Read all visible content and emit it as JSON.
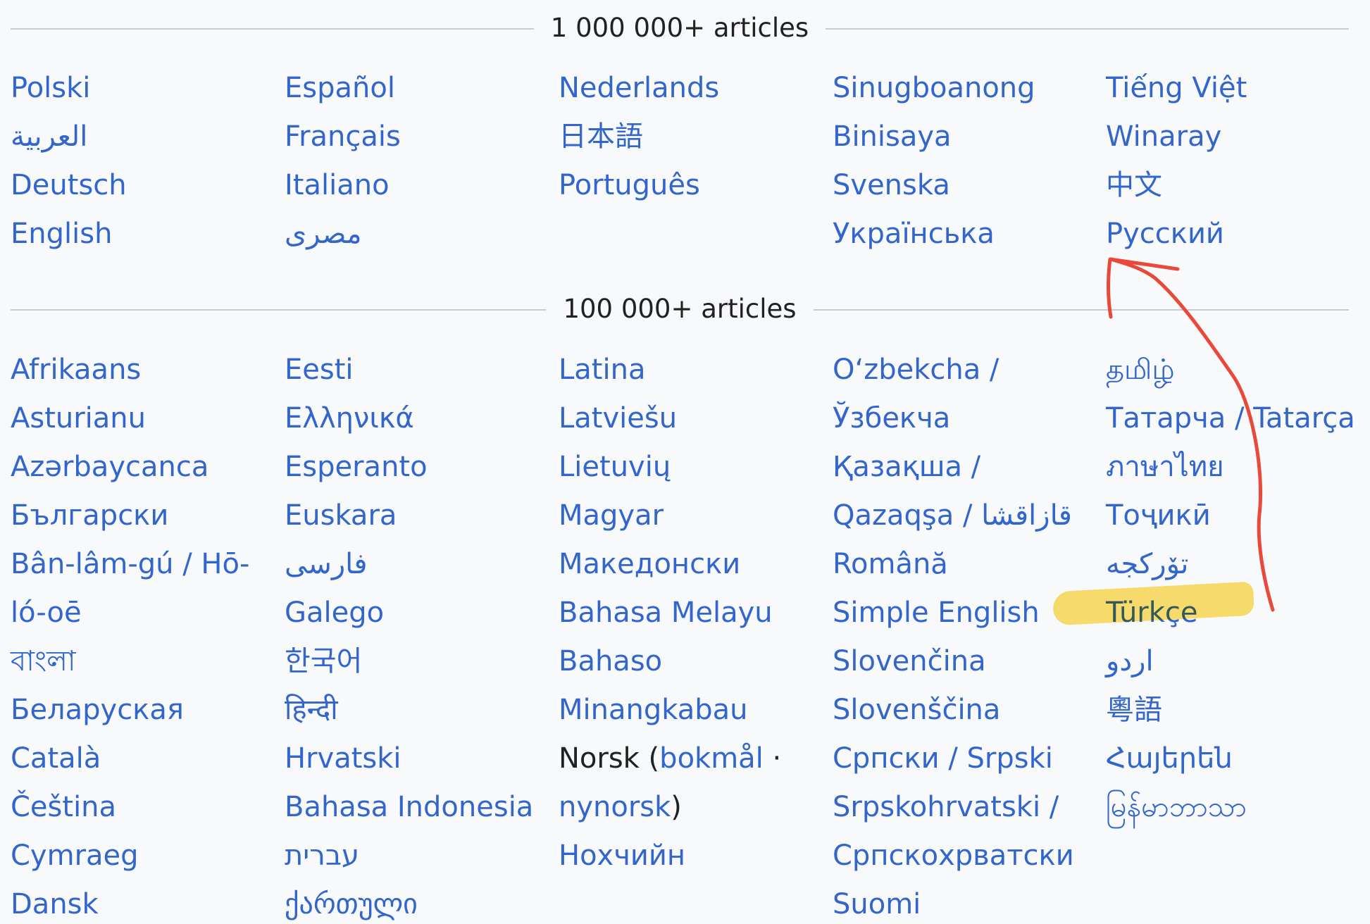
{
  "section_million": {
    "title": "1 000 000+ articles",
    "columns": [
      [
        "Polski",
        "العربية",
        "Deutsch",
        "English"
      ],
      [
        "Español",
        "Français",
        "Italiano",
        "مصرى"
      ],
      [
        "Nederlands",
        "日本語",
        "Português"
      ],
      [
        "Sinugboanong",
        "Binisaya",
        "Svenska",
        "Українська"
      ],
      [
        "Tiếng Việt",
        "Winaray",
        "中文",
        "Русский"
      ]
    ]
  },
  "section_100k": {
    "title": "100 000+ articles",
    "columns": [
      [
        "Afrikaans",
        "Asturianu",
        "Azərbaycanca",
        "Български",
        "Bân-lâm-gú / Hō-",
        "ló-oē",
        "বাংলা",
        "Беларуская",
        "Català",
        "Čeština",
        "Cymraeg",
        "Dansk"
      ],
      [
        "Eesti",
        "Ελληνικά",
        "Esperanto",
        "Euskara",
        "فارسی",
        "Galego",
        "한국어",
        "हिन्दी",
        "Hrvatski",
        "Bahasa Indonesia",
        "עברית",
        "ქართული"
      ],
      [
        "Latina",
        "Latviešu",
        "Lietuvių",
        "Magyar",
        "Македонски",
        "Bahasa Melayu",
        "Bahaso",
        "Minangkabau",
        "",
        "",
        "Нохчийн"
      ],
      [
        "Oʻzbekcha /",
        "Ўзбекча",
        "Қазақша /",
        "Qazaqşa / قازاقشا",
        "Română",
        "Simple English",
        "Slovenčina",
        "Slovenščina",
        "Српски / Srpski",
        "Srpskohrvatski /",
        "Српскохрватски",
        "Suomi"
      ],
      [
        "தமிழ்",
        "Татарча / Tatarça",
        "ภาษาไทย",
        "Тоҷикӣ",
        "تۆرکجه",
        "Türkçe",
        "اردو",
        "粵語",
        "Հայերեն",
        "မြန်မာဘာသာ"
      ]
    ],
    "norsk": {
      "prefix": "Norsk (",
      "bokmal": "bokmål",
      "separator": " ·",
      "nynorsk": "nynorsk",
      "suffix": ")"
    }
  },
  "annotation": {
    "highlight_target": "Türkçe",
    "arrow_target": "Русский",
    "highlight_color": "#fdd53e",
    "arrow_color": "#e8493a"
  },
  "colors": {
    "link": "#3366cc",
    "text": "#202122",
    "rule": "#c8ccd1",
    "background": "#f8f9fa"
  }
}
